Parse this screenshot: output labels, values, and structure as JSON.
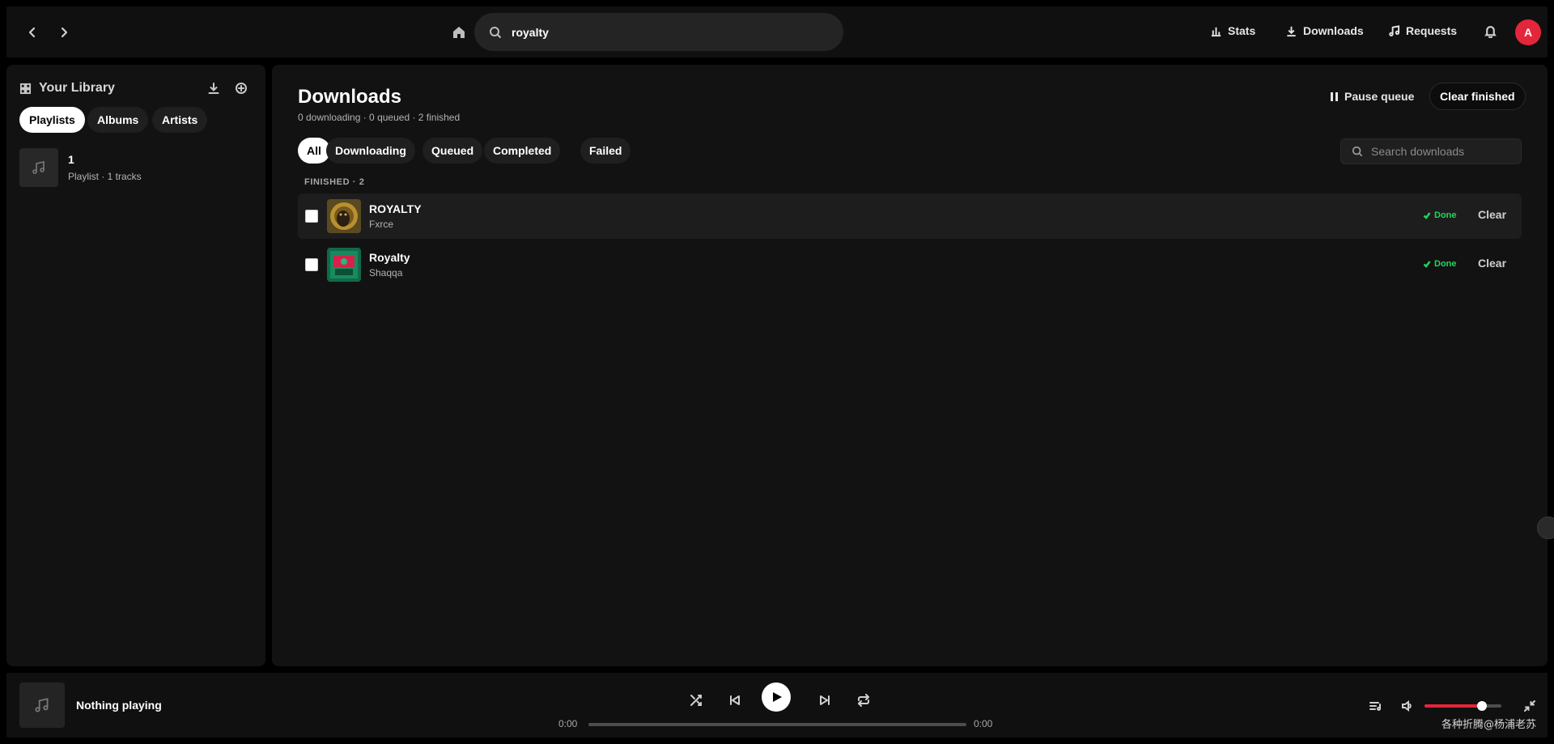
{
  "topbar": {
    "search_value": "royalty",
    "links": {
      "stats": "Stats",
      "downloads": "Downloads",
      "requests": "Requests"
    },
    "avatar_letter": "A",
    "accent_color": "#e3263b"
  },
  "library": {
    "title": "Your Library",
    "tabs": {
      "playlists": "Playlists",
      "albums": "Albums",
      "artists": "Artists"
    },
    "items": [
      {
        "name": "1",
        "subtitle": "Playlist · 1 tracks"
      }
    ]
  },
  "downloads": {
    "title": "Downloads",
    "summary": "0 downloading · 0 queued · 2 finished",
    "pause_label": "Pause queue",
    "clear_finished_label": "Clear finished",
    "filters": {
      "all": "All",
      "downloading": "Downloading",
      "queued": "Queued",
      "completed": "Completed",
      "failed": "Failed"
    },
    "search_placeholder": "Search downloads",
    "section_label": "FINISHED · 2",
    "rows": [
      {
        "title": "ROYALTY",
        "artist": "Fxrce",
        "status": "Done",
        "clear": "Clear"
      },
      {
        "title": "Royalty",
        "artist": "Shaqqa",
        "status": "Done",
        "clear": "Clear"
      }
    ]
  },
  "player": {
    "now_playing": "Nothing playing",
    "elapsed": "0:00",
    "duration": "0:00",
    "progress": 0,
    "volume": 0.75
  },
  "watermark": "各种折腾@杨浦老苏"
}
